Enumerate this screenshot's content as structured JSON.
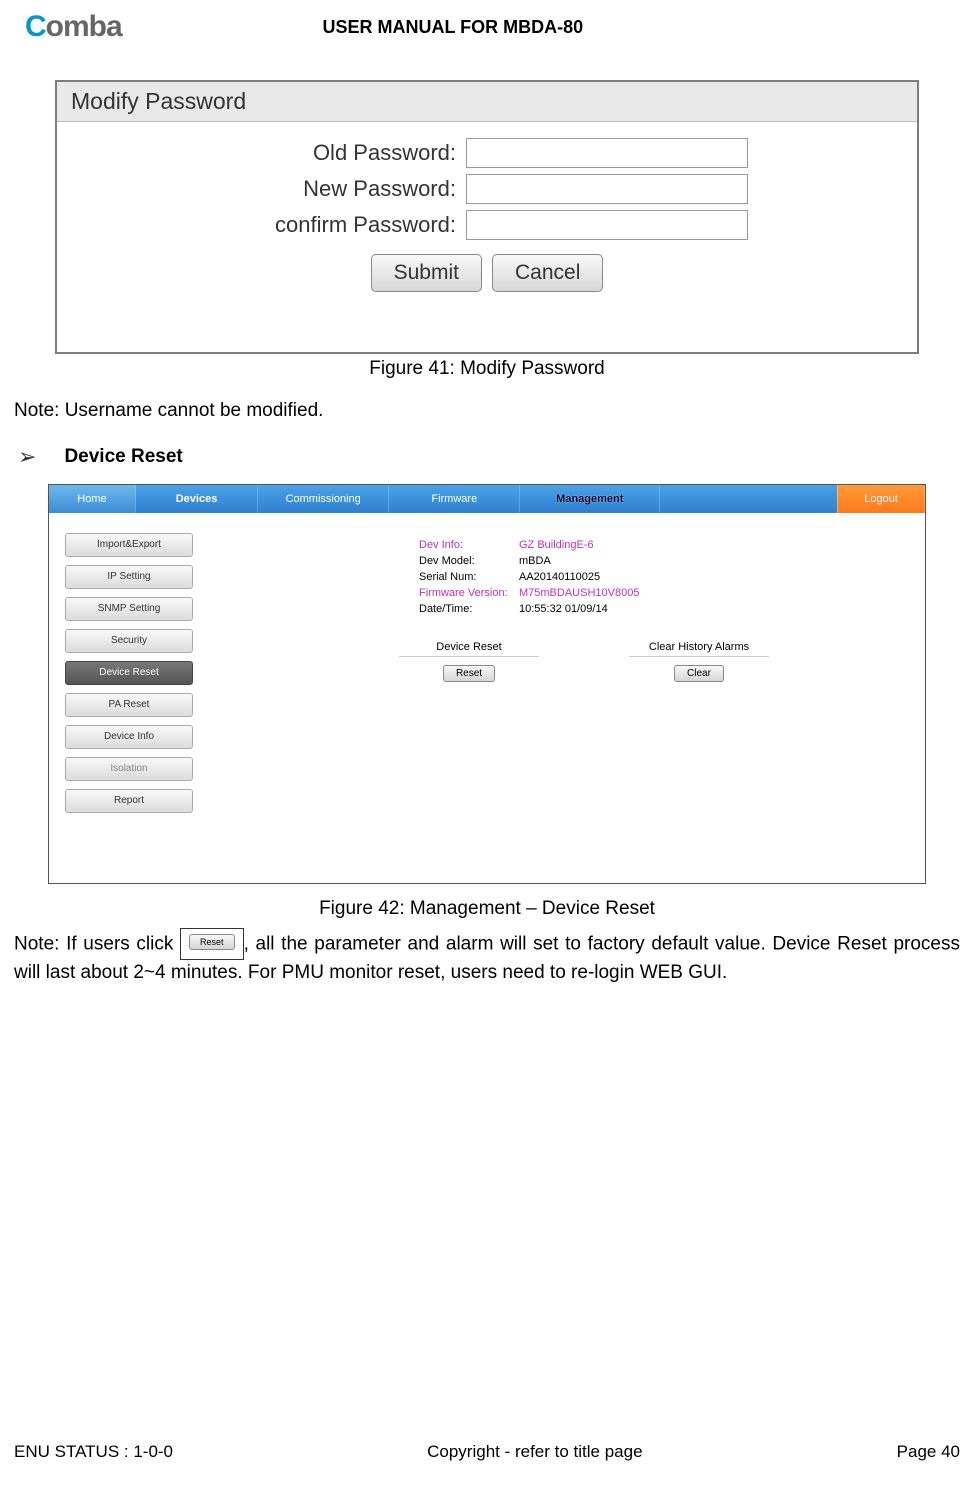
{
  "header": {
    "logo_left": "C",
    "logo_right": "omba",
    "title": "USER MANUAL FOR MBDA-80"
  },
  "fig41": {
    "window_title": "Modify Password",
    "labels": {
      "old": "Old Password:",
      "new": "New Password:",
      "confirm": "confirm Password:"
    },
    "buttons": {
      "submit": "Submit",
      "cancel": "Cancel"
    },
    "caption": "Figure 41: Modify Password"
  },
  "note1": "Note: Username cannot be modified.",
  "bullet1": "Device Reset",
  "fig42": {
    "nav": {
      "home": "Home",
      "devices": "Devices",
      "commissioning": "Commissioning",
      "firmware": "Firmware",
      "management": "Management",
      "logout": "Logout"
    },
    "sidebar": [
      "Import&Export",
      "IP Setting",
      "SNMP Setting",
      "Security",
      "Device Reset",
      "PA Reset",
      "Device Info",
      "Isolation",
      "Report"
    ],
    "sidebar_active_index": 4,
    "info": [
      {
        "label": "Dev Info:",
        "value": "GZ BuildingE-6",
        "highlight": true
      },
      {
        "label": "Dev Model:",
        "value": "mBDA",
        "highlight": false
      },
      {
        "label": "Serial Num:",
        "value": "AA20140110025",
        "highlight": false
      },
      {
        "label": "Firmware Version:",
        "value": "M75mBDAUSH10V8005",
        "highlight": true
      },
      {
        "label": "Date/Time:",
        "value": "10:55:32 01/09/14",
        "highlight": false
      }
    ],
    "reset": {
      "col1_title": "Device Reset",
      "col1_button": "Reset",
      "col2_title": "Clear History Alarms",
      "col2_button": "Clear"
    },
    "caption": "Figure 42: Management – Device Reset"
  },
  "note2": {
    "prefix": "Note: If users click",
    "inline_button": "Reset",
    "rest": ", all the parameter and alarm will set to factory default value. Device Reset process will last about 2~4 minutes. For PMU monitor reset, users need to re-login WEB GUI."
  },
  "footer": {
    "left": "ENU STATUS : 1-0-0",
    "center": "Copyright - refer to title page",
    "right": "Page 40"
  }
}
